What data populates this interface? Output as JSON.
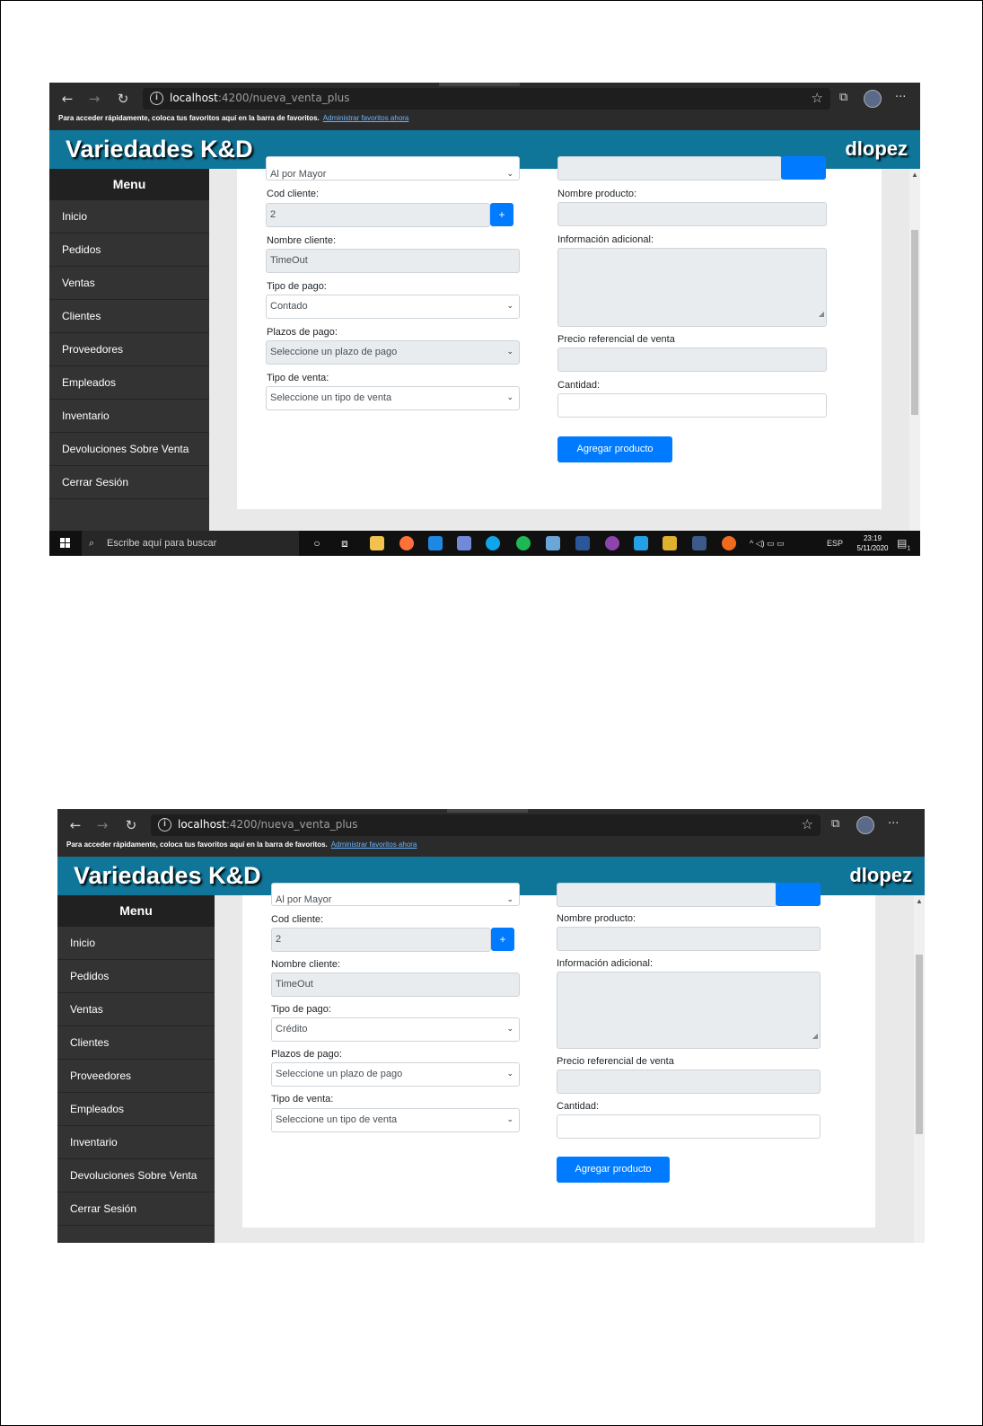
{
  "browser": {
    "url_host": "localhost",
    "url_path": ":4200/nueva_venta_plus",
    "favorites_bar_text": "Para acceder rápidamente, coloca tus favoritos aquí en la barra de favoritos.",
    "favorites_bar_link": "Administrar favoritos ahora"
  },
  "app": {
    "brand": "Variedades K&D",
    "username": "dlopez",
    "header_color": "#0f7699",
    "primary_color": "#007bff"
  },
  "sidebar": {
    "title": "Menu",
    "items": [
      {
        "label": "Inicio"
      },
      {
        "label": "Pedidos"
      },
      {
        "label": "Ventas"
      },
      {
        "label": "Clientes"
      },
      {
        "label": "Proveedores"
      },
      {
        "label": "Empleados"
      },
      {
        "label": "Inventario"
      },
      {
        "label": "Devoluciones Sobre Venta"
      },
      {
        "label": "Cerrar Sesión"
      }
    ]
  },
  "form": {
    "top_select_partial": "Al por Mayor",
    "cod_cliente_label": "Cod cliente:",
    "cod_cliente_value": "2",
    "add_button": "+",
    "nombre_cliente_label": "Nombre cliente:",
    "nombre_cliente_value": "TimeOut",
    "tipo_pago_label": "Tipo de pago:",
    "plazos_label": "Plazos de pago:",
    "plazos_value": "Seleccione un plazo de pago",
    "tipo_venta_label": "Tipo de venta:",
    "tipo_venta_value": "Seleccione un tipo de venta",
    "nombre_producto_label": "Nombre producto:",
    "info_adicional_label": "Información adicional:",
    "precio_label": "Precio referencial de venta",
    "cantidad_label": "Cantidad:",
    "agregar_button": "Agregar producto"
  },
  "screens": [
    {
      "tipo_pago_value": "Contado"
    },
    {
      "tipo_pago_value": "Crédito"
    }
  ],
  "taskbar": {
    "search_placeholder": "Escribe aquí para buscar",
    "language": "ESP",
    "time": "23:19",
    "date": "5/11/2020",
    "notifications": "1"
  }
}
